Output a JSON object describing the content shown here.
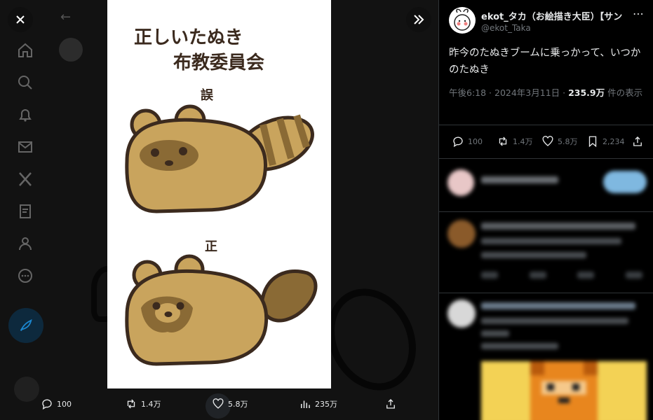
{
  "media": {
    "caption_title": "正しいたぬき布教委員会",
    "label_wrong": "誤",
    "label_right": "正",
    "actions": {
      "replies": "100",
      "retweets": "1.4万",
      "likes": "5.8万",
      "views": "235万"
    },
    "controls": {
      "close_icon": "close-icon",
      "expand_icon": "double-chevron-right-icon"
    }
  },
  "background_timeline": {
    "nav_icons": [
      "home-icon",
      "search-icon",
      "bell-icon",
      "mail-icon",
      "x-logo-icon",
      "list-icon",
      "person-icon",
      "more-circle-icon"
    ],
    "compose_icon": "feather-icon"
  },
  "tweet": {
    "author_name": "ekot_タカ（お絵描き大臣）【サン",
    "author_handle": "@ekot_Taka",
    "text": "昨今のたぬきブームに乗っかって、いつかのたぬき",
    "time": "午後6:18 · 2024年3月11日 · ",
    "views_count": "235.9万",
    "views_label": " 件の表示",
    "stats": {
      "replies": "100",
      "retweets": "1.4万",
      "likes": "5.8万",
      "bookmarks": "2,234"
    }
  },
  "colors": {
    "accent": "#1d9bf0",
    "tanuki_body": "#c9a45d",
    "tanuki_dark": "#8a6a35",
    "outline": "#3b2a1e"
  }
}
